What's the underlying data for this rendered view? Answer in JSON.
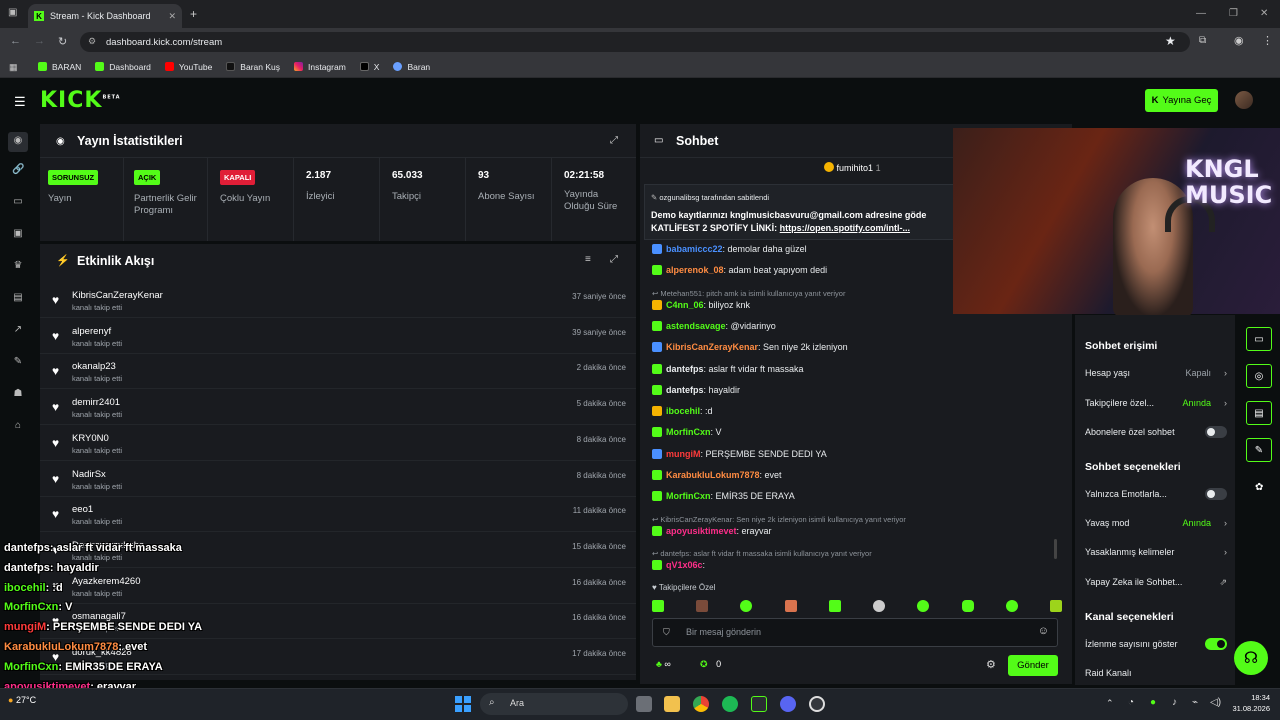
{
  "browser": {
    "tab_title": "Stream - Kick Dashboard",
    "url": "dashboard.kick.com/stream",
    "bookmarks": [
      "BARAN",
      "Dashboard",
      "YouTube",
      "Baran Kuş",
      "Instagram",
      "X",
      "Baran"
    ]
  },
  "header": {
    "logo": "KICK",
    "logo_beta": "BETA",
    "go_live": "Yayına Geç"
  },
  "stats": {
    "title": "Yayın İstatistikleri",
    "cells": [
      {
        "badge": "SORUNSUZ",
        "label": "Yayın"
      },
      {
        "badge": "AÇIK",
        "label": "Partnerlik Gelir Programı"
      },
      {
        "badge": "KAPALI",
        "label": "Çoklu Yayın"
      },
      {
        "value": "2.187",
        "label": "İzleyici"
      },
      {
        "value": "65.033",
        "label": "Takipçi"
      },
      {
        "value": "93",
        "label": "Abone Sayısı"
      },
      {
        "value": "02:21:58",
        "label": "Yayında Olduğu Süre"
      }
    ]
  },
  "activity": {
    "title": "Etkinlik Akışı",
    "items": [
      {
        "name": "KibrisCanZerayKenar",
        "sub": "kanalı takip etti",
        "time": "37 saniye önce"
      },
      {
        "name": "alperenyf",
        "sub": "kanalı takip etti",
        "time": "39 saniye önce"
      },
      {
        "name": "okanalp23",
        "sub": "kanalı takip etti",
        "time": "2 dakika önce"
      },
      {
        "name": "demirr2401",
        "sub": "kanalı takip etti",
        "time": "5 dakika önce"
      },
      {
        "name": "KRY0N0",
        "sub": "kanalı takip etti",
        "time": "8 dakika önce"
      },
      {
        "name": "NadirSx",
        "sub": "kanalı takip etti",
        "time": "8 dakika önce"
      },
      {
        "name": "eeo1",
        "sub": "kanalı takip etti",
        "time": "11 dakika önce"
      },
      {
        "name": "Destroyerzuhaha",
        "sub": "kanalı takip etti",
        "time": "15 dakika önce"
      },
      {
        "name": "Ayazkerem4260",
        "sub": "kanalı takip etti",
        "time": "16 dakika önce"
      },
      {
        "name": "osmanagali7",
        "sub": "kanalı takip etti",
        "time": "16 dakika önce"
      },
      {
        "name": "doruk_kk4828",
        "sub": "kanalı takip etti",
        "time": "17 dakika önce"
      }
    ]
  },
  "chat": {
    "title": "Sohbet",
    "top_user": "fumihito1",
    "top_count": "1",
    "pinned_by": "ozgunalibsg tarafından sabitlendi",
    "pinned_line1": "Demo kayıtlarınızı knglmusicbasvuru@gmail.com adresine göde",
    "pinned_line2_prefix": "KATLİFEST 2 SPOTİFY LİNKİ: ",
    "pinned_link": "https://open.spotify.com/intl-...",
    "messages": [
      {
        "user": "babamiccc22",
        "text": ": demolar daha güzel",
        "color": "#4a90ff"
      },
      {
        "user": "alperenok_08",
        "text": ": adam beat yapıyom dedi",
        "color": "#ff8c42"
      },
      {
        "reply": "Metehan551: pitch amk ia isimli kullanıcıya yanıt veriyor"
      },
      {
        "user": "C4nn_06",
        "text": ": biliyoz knk",
        "color": "#53fc18"
      },
      {
        "user": "astendsavage",
        "text": ": @vidarinyo",
        "color": "#53fc18"
      },
      {
        "user": "KibrisCanZerayKenar",
        "text": ": Sen niye 2k izleniyon",
        "color": "#ff8c42"
      },
      {
        "user": "dantefps",
        "text": ": aslar ft vidar ft massaka",
        "color": "#e9ecee"
      },
      {
        "user": "dantefps",
        "text": ": hayaldir",
        "color": "#e9ecee"
      },
      {
        "user": "ibocehil",
        "text": ": :d",
        "color": "#53fc18"
      },
      {
        "user": "MorfinCxn",
        "text": ": V",
        "color": "#53fc18"
      },
      {
        "user": "mungiM",
        "text": ": PERŞEMBE SENDE DEDI YA",
        "color": "#ff3b3b"
      },
      {
        "user": "KarabukluLokum7878",
        "text": ": evet",
        "color": "#ff8c42"
      },
      {
        "user": "MorfinCxn",
        "text": ": EMİR35 DE ERAYA",
        "color": "#53fc18"
      },
      {
        "reply": "KibrisCanZerayKenar: Sen niye 2k izleniyon isimli kullanıcıya yanıt veriyor"
      },
      {
        "user": "apoyusiktimevet",
        "text": ": erayvar",
        "color": "#ff2e8a"
      },
      {
        "reply": "dantefps: aslar ft vidar ft massaka isimli kullanıcıya yanıt veriyor"
      },
      {
        "user": "qV1x06c",
        "text": ":",
        "color": "#ff2e8a"
      }
    ],
    "followers_only": "Takipçilere Özel",
    "input_placeholder": "Bir mesaj gönderin",
    "count_a": "0",
    "send": "Gönder"
  },
  "webcam": {
    "logo_line1": "KNGL",
    "logo_line2": "MUSIC"
  },
  "settings": {
    "access_title": "Sohbet erişimi",
    "rows1": [
      {
        "label": "Hesap yaşı",
        "value": "Kapalı"
      },
      {
        "label": "Takipçilere özel...",
        "value": "Anında"
      },
      {
        "label": "Abonelere özel sohbet",
        "toggle": false
      }
    ],
    "options_title": "Sohbet seçenekleri",
    "rows2": [
      {
        "label": "Yalnızca Emotlarla...",
        "toggle": false
      },
      {
        "label": "Yavaş mod",
        "value": "Anında"
      },
      {
        "label": "Yasaklanmış kelimeler"
      },
      {
        "label": "Yapay Zeka ile Sohbet..."
      }
    ],
    "channel_title": "Kanal seçenekleri",
    "rows3": [
      {
        "label": "İzlenme sayısını göster",
        "toggle": true
      },
      {
        "label": "Raid Kanalı"
      }
    ]
  },
  "overlay": [
    {
      "user": "dantefps",
      "text": ": aslar ft vidar ft massaka",
      "color": "#ffffff"
    },
    {
      "user": "dantefps",
      "text": ": hayaldir",
      "color": "#ffffff"
    },
    {
      "user": "ibocehil",
      "text": ": :d",
      "color": "#53fc18"
    },
    {
      "user": "MorfinCxn",
      "text": ": V",
      "color": "#53fc18"
    },
    {
      "user": "mungiM",
      "text": ": PERŞEMBE SENDE DEDI YA",
      "color": "#ff3b3b"
    },
    {
      "user": "KarabukluLokum7878",
      "text": ": evet",
      "color": "#ff8c42"
    },
    {
      "user": "MorfinCxn",
      "text": ": EMİR35 DE ERAYA",
      "color": "#53fc18"
    },
    {
      "user": "apoyusiktimevet",
      "text": ": erayvar",
      "color": "#ff2e8a"
    },
    {
      "user": "qV1x06c",
      "text": ":",
      "color": "#ff2e8a"
    }
  ],
  "taskbar": {
    "search": "Ara",
    "weather": "27°C",
    "time": "18:34",
    "date": "31.08.2026"
  }
}
